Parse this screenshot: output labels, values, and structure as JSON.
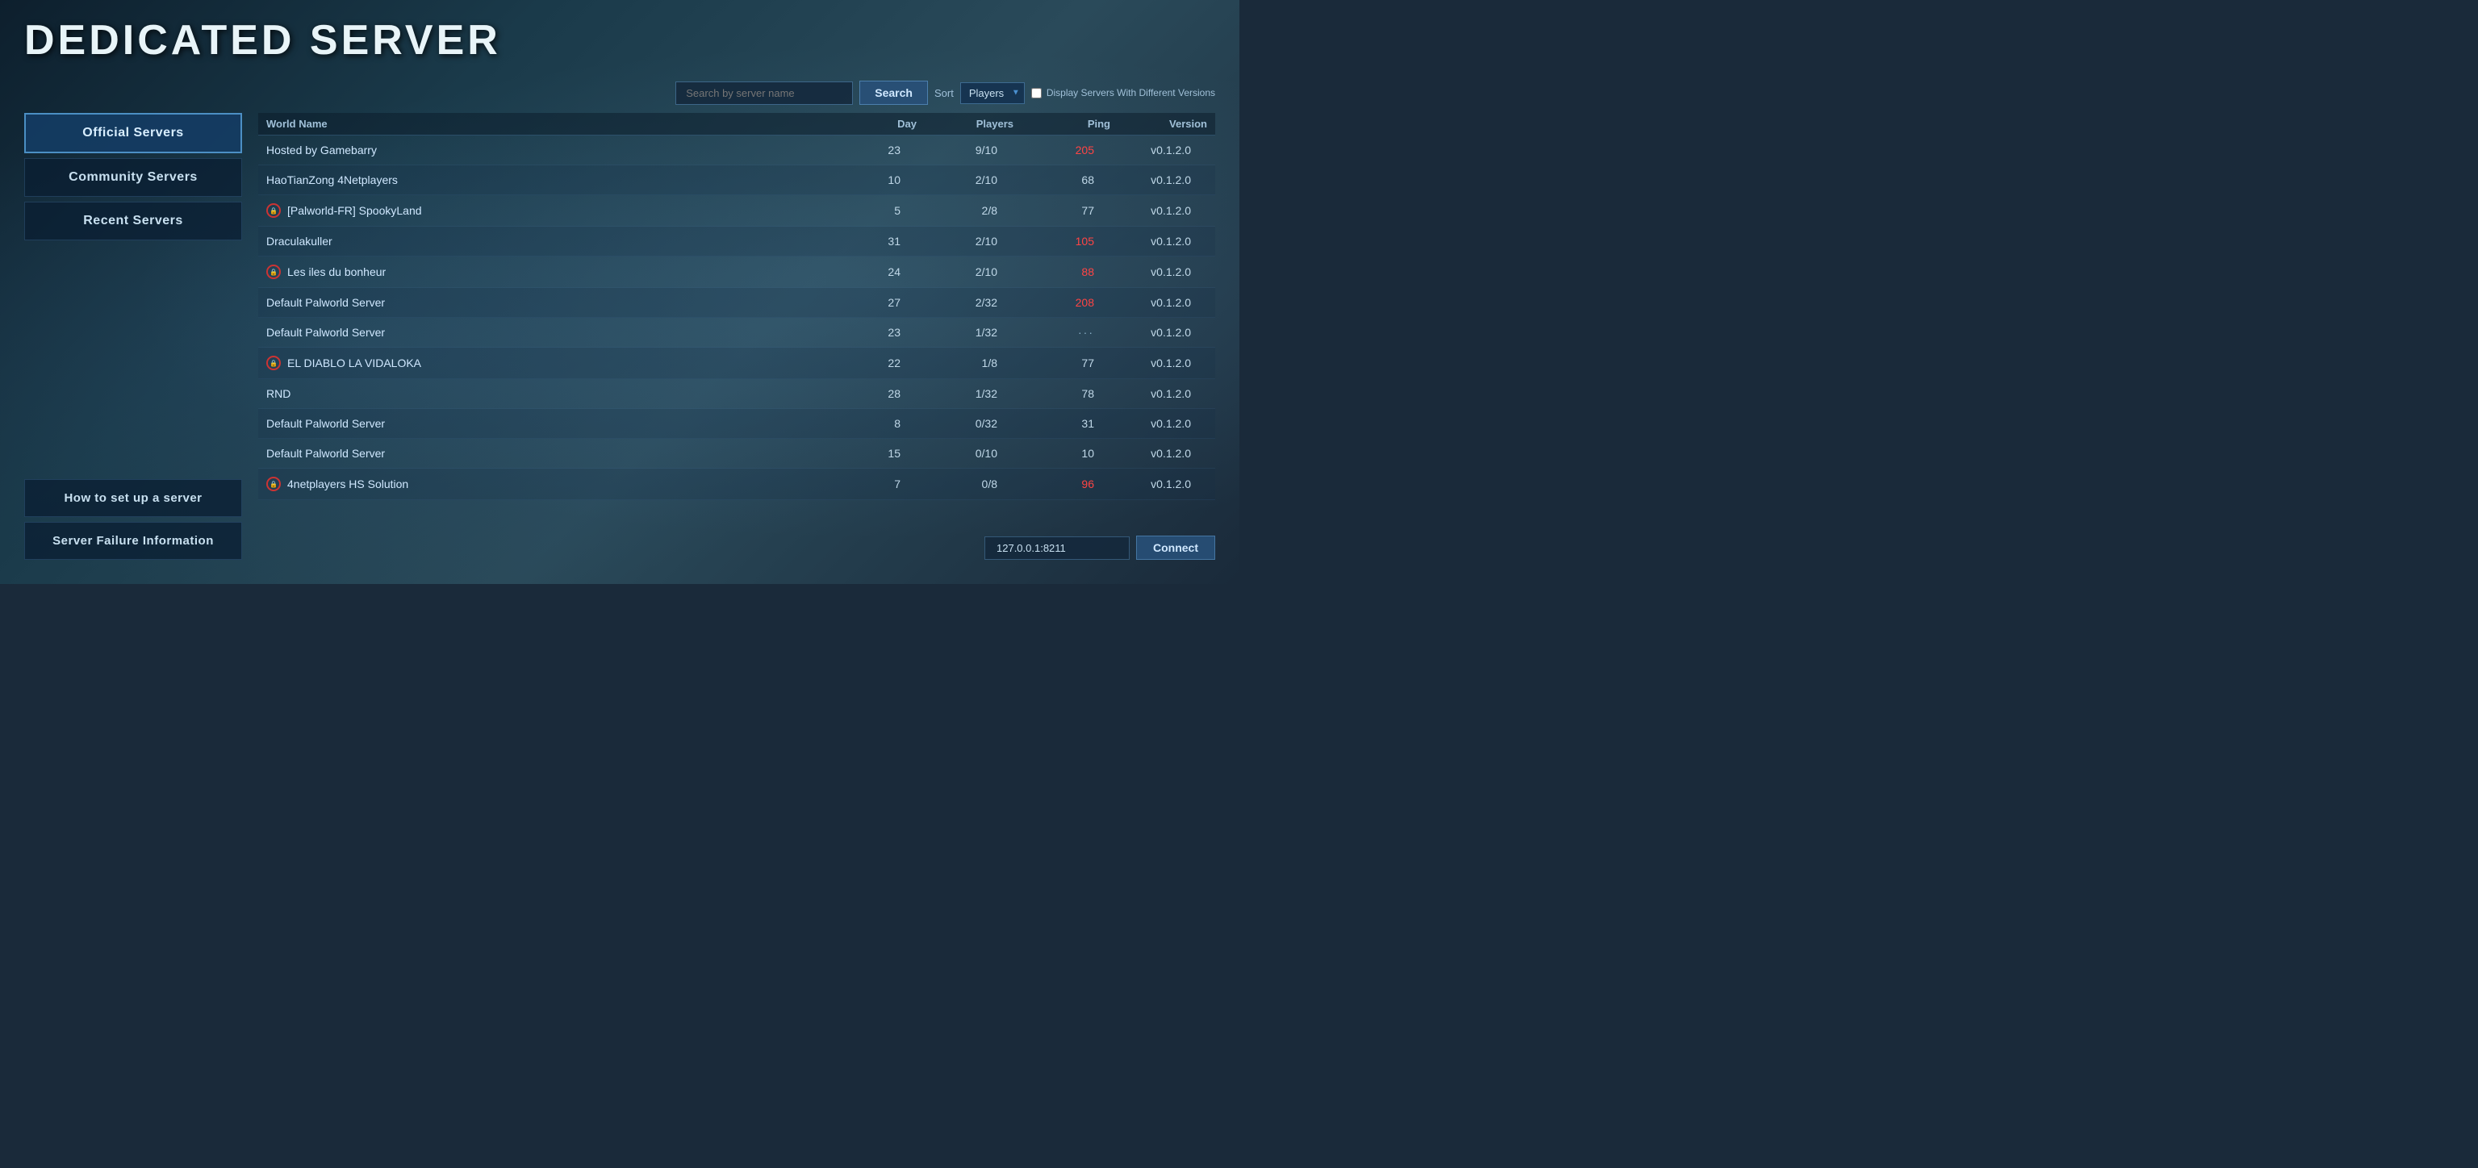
{
  "page": {
    "title": "DEDICATED SERVER"
  },
  "sidebar": {
    "nav_buttons": [
      {
        "id": "official",
        "label": "Official Servers",
        "active": true
      },
      {
        "id": "community",
        "label": "Community Servers",
        "active": false
      },
      {
        "id": "recent",
        "label": "Recent Servers",
        "active": false
      }
    ],
    "bottom_buttons": [
      {
        "id": "setup",
        "label": "How to set up a server"
      },
      {
        "id": "failure",
        "label": "Server Failure Information"
      }
    ]
  },
  "toolbar": {
    "search_placeholder": "Search by server name",
    "search_label": "Search",
    "sort_label": "Sort",
    "sort_value": "Players",
    "display_option_label": "Display Servers With Different Versions"
  },
  "table": {
    "headers": [
      {
        "id": "world-name",
        "label": "World Name",
        "align": "left"
      },
      {
        "id": "day",
        "label": "Day",
        "align": "right"
      },
      {
        "id": "players",
        "label": "Players",
        "align": "right"
      },
      {
        "id": "ping",
        "label": "Ping",
        "align": "right"
      },
      {
        "id": "version",
        "label": "Version",
        "align": "right"
      }
    ],
    "rows": [
      {
        "name": "Hosted by Gamebarry",
        "locked": false,
        "day": "23",
        "players": "9/10",
        "ping": "205",
        "ping_red": true,
        "version": "v0.1.2.0"
      },
      {
        "name": "HaoTianZong 4Netplayers",
        "locked": false,
        "day": "10",
        "players": "2/10",
        "ping": "68",
        "ping_red": false,
        "version": "v0.1.2.0"
      },
      {
        "name": "[Palworld-FR] SpookyLand",
        "locked": true,
        "day": "5",
        "players": "2/8",
        "ping": "77",
        "ping_red": false,
        "version": "v0.1.2.0"
      },
      {
        "name": "Draculakuller",
        "locked": false,
        "day": "31",
        "players": "2/10",
        "ping": "105",
        "ping_red": true,
        "version": "v0.1.2.0"
      },
      {
        "name": "Les iles du bonheur",
        "locked": true,
        "day": "24",
        "players": "2/10",
        "ping": "88",
        "ping_red": true,
        "version": "v0.1.2.0"
      },
      {
        "name": "Default Palworld Server",
        "locked": false,
        "day": "27",
        "players": "2/32",
        "ping": "208",
        "ping_red": true,
        "version": "v0.1.2.0"
      },
      {
        "name": "Default Palworld Server",
        "locked": false,
        "day": "23",
        "players": "1/32",
        "ping": "···",
        "ping_red": false,
        "ping_dots": true,
        "version": "v0.1.2.0"
      },
      {
        "name": "EL DIABLO LA VIDALOKA",
        "locked": true,
        "day": "22",
        "players": "1/8",
        "ping": "77",
        "ping_red": false,
        "version": "v0.1.2.0"
      },
      {
        "name": "RND",
        "locked": false,
        "day": "28",
        "players": "1/32",
        "ping": "78",
        "ping_red": false,
        "version": "v0.1.2.0"
      },
      {
        "name": "Default Palworld Server",
        "locked": false,
        "day": "8",
        "players": "0/32",
        "ping": "31",
        "ping_red": false,
        "version": "v0.1.2.0"
      },
      {
        "name": "Default Palworld Server",
        "locked": false,
        "day": "15",
        "players": "0/10",
        "ping": "10",
        "ping_red": false,
        "version": "v0.1.2.0"
      },
      {
        "name": "4netplayers HS Solution",
        "locked": true,
        "day": "7",
        "players": "0/8",
        "ping": "96",
        "ping_red": true,
        "version": "v0.1.2.0"
      }
    ]
  },
  "bottom": {
    "ip_value": "127.0.0.1:8211",
    "connect_label": "Connect"
  }
}
